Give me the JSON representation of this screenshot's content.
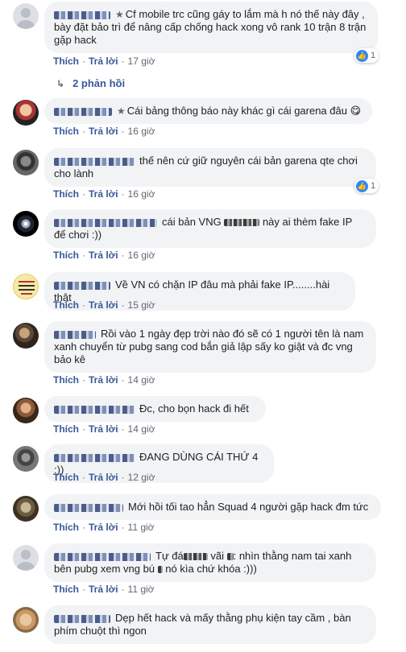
{
  "actions": {
    "like": "Thích",
    "reply": "Trả lời"
  },
  "replies_link": "2 phản hồi",
  "comments": [
    {
      "text": "Cf mobile trc cũng gáy to lắm mà h nó thế này đây , bày đặt bảo trì để nâng cấp chống hack xong vô rank 10 trận 8 trận gặp hack",
      "time": "17 giờ",
      "likes": "1"
    },
    {
      "text": "Cái bảng thông báo này khác gì cái garena đâu",
      "emoji": "😋",
      "time": "16 giờ"
    },
    {
      "text": "thế nên cứ giữ nguyên cái bản garena qte chơi cho lành",
      "time": "16 giờ",
      "likes": "1"
    },
    {
      "text_a": "cái bản VNG",
      "text_b": "này ai thèm fake IP để chơi :))",
      "time": "16 giờ"
    },
    {
      "text": "Về VN có chặn IP đâu mà phải fake IP........hài thật",
      "time": "15 giờ"
    },
    {
      "text": "Rồi vào 1 ngày đẹp trời nào đó sẽ có 1 người tên là nam xanh chuyển từ pubg sang cod bắn giả lập sấy ko giật và đc vng bảo kê",
      "time": "14 giờ"
    },
    {
      "text": "Đc, cho bọn hack đi hết",
      "time": "14 giờ"
    },
    {
      "text": "ĐANG DÙNG CÁI THỨ 4 :))",
      "time": "12 giờ"
    },
    {
      "text": "Mới hồi tối tao hẳn Squad 4 người gặp hack đm tức",
      "time": "11 giờ"
    },
    {
      "text_a": "Tự đá",
      "text_b": "vãi",
      "text_c": "nhìn thằng nam tai xanh bên pubg xem vng bú",
      "text_d": "nó kìa chứ khóa :)))",
      "time": "11 giờ"
    },
    {
      "text": "Dẹp hết hack và mấy thằng phụ kiện tay cầm , bàn phím chuột thì ngon",
      "time": "11 giờ"
    }
  ],
  "colors": {
    "link": "#385898",
    "bubble": "#f2f3f5",
    "meta": "#606770",
    "like_blue": "#2d88ff"
  },
  "icons": {
    "reply_arrow": "reply-arrow-icon",
    "like": "like-reaction-icon",
    "star": "top-fan-star-icon"
  }
}
